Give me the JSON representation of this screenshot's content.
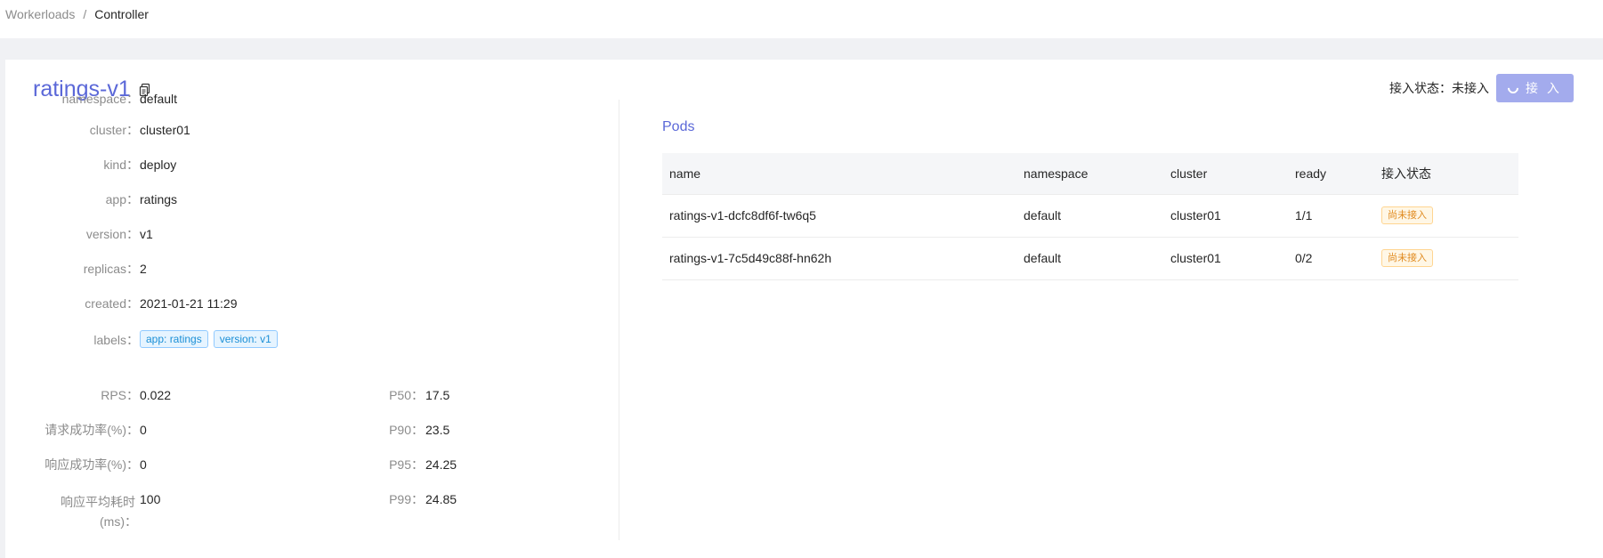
{
  "breadcrumb": {
    "parent": "Workerloads",
    "separator": "/",
    "current": "Controller"
  },
  "header": {
    "title": "ratings-v1",
    "access_status_label": "接入状态：",
    "access_status_value": "未接入",
    "connect_button": "接 入"
  },
  "details": [
    {
      "label": "namespace：",
      "value": "default"
    },
    {
      "label": "cluster：",
      "value": "cluster01"
    },
    {
      "label": "kind：",
      "value": "deploy"
    },
    {
      "label": "app：",
      "value": "ratings"
    },
    {
      "label": "version：",
      "value": "v1"
    },
    {
      "label": "replicas：",
      "value": "2"
    },
    {
      "label": "created：",
      "value": "2021-01-21 11:29"
    }
  ],
  "labels": {
    "label": "labels：",
    "tags": [
      "app: ratings",
      "version: v1"
    ]
  },
  "metrics_left": [
    {
      "label": "RPS：",
      "value": "0.022"
    },
    {
      "label": "请求成功率(%)：",
      "value": "0"
    },
    {
      "label": "响应成功率(%)：",
      "value": "0"
    },
    {
      "label_line1": "响应平均耗时",
      "label_line2": "(ms)：",
      "value": "100"
    }
  ],
  "metrics_right": [
    {
      "label": "P50：",
      "value": "17.5"
    },
    {
      "label": "P90：",
      "value": "23.5"
    },
    {
      "label": "P95：",
      "value": "24.25"
    },
    {
      "label": "P99：",
      "value": "24.85"
    }
  ],
  "pods": {
    "title": "Pods",
    "columns": [
      "name",
      "namespace",
      "cluster",
      "ready",
      "接入状态"
    ],
    "rows": [
      {
        "name": "ratings-v1-dcfc8df6f-tw6q5",
        "namespace": "default",
        "cluster": "cluster01",
        "ready": "1/1",
        "status": "尚未接入"
      },
      {
        "name": "ratings-v1-7c5d49c88f-hn62h",
        "namespace": "default",
        "cluster": "cluster01",
        "ready": "0/2",
        "status": "尚未接入"
      }
    ]
  },
  "colors": {
    "accent": "#5b68d8",
    "button": "#a3abed",
    "warning": "#e08a1e",
    "tag": "#1b8fd6"
  }
}
